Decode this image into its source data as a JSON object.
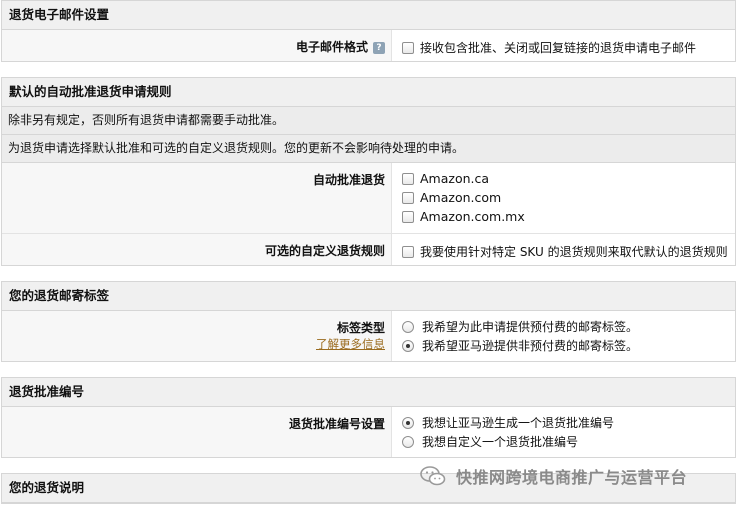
{
  "email_section": {
    "title": "退货电子邮件设置",
    "format_label": "电子邮件格式",
    "help_icon": "?",
    "option": "接收包含批准、关闭或回复链接的退货申请电子邮件"
  },
  "auto_section": {
    "title": "默认的自动批准退货申请规则",
    "note1": "除非另有规定，否则所有退货申请都需要手动批准。",
    "note2": "为退货申请选择默认批准和可选的自定义退货规则。您的更新不会影响待处理的申请。",
    "auto_label": "自动批准退货",
    "marketplaces": [
      "Amazon.ca",
      "Amazon.com",
      "Amazon.com.mx"
    ],
    "custom_label": "可选的自定义退货规则",
    "custom_option": "我要使用针对特定 SKU 的退货规则来取代默认的退货规则"
  },
  "label_section": {
    "title": "您的退货邮寄标签",
    "type_label": "标签类型",
    "learn_more": "了解更多信息",
    "options": [
      "我希望为此申请提供预付费的邮寄标签。",
      "我希望亚马逊提供非预付费的邮寄标签。"
    ],
    "selected_index": 1
  },
  "rma_section": {
    "title": "退货批准编号",
    "setting_label": "退货批准编号设置",
    "options": [
      "我想让亚马逊生成一个退货批准编号",
      "我想自定义一个退货批准编号"
    ],
    "selected_index": 0
  },
  "instructions_section": {
    "title": "您的退货说明"
  },
  "watermark": {
    "text": "快推网跨境电商推广与运营平台",
    "icon": "wechat-icon"
  }
}
